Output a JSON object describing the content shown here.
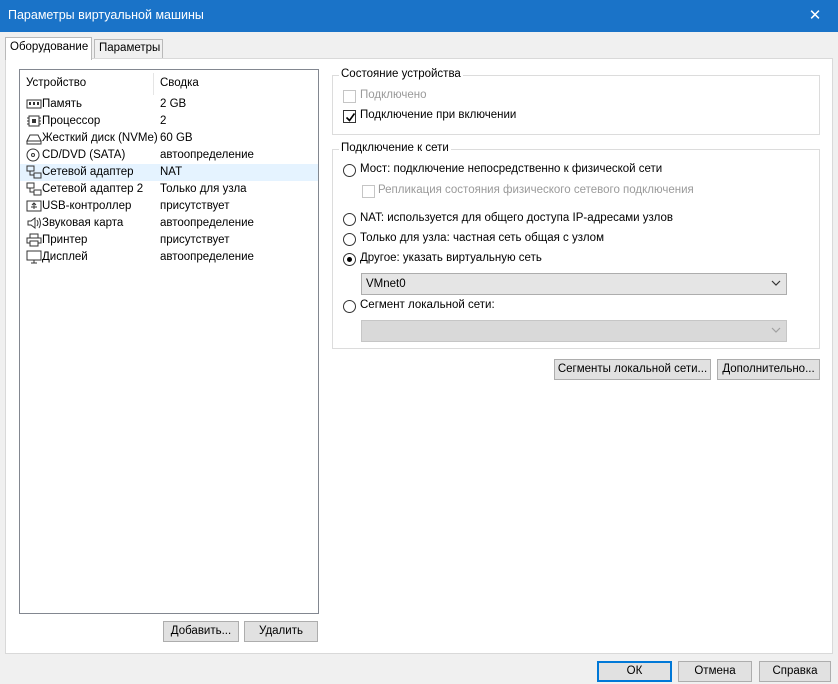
{
  "window": {
    "title": "Параметры виртуальной машины",
    "close_glyph": "✕"
  },
  "tabs": [
    {
      "label": "Оборудование"
    },
    {
      "label": "Параметры"
    }
  ],
  "device_list": {
    "header_device": "Устройство",
    "header_summary": "Сводка",
    "rows": [
      {
        "name": "Память",
        "summary": "2 GB",
        "icon": "memory-icon"
      },
      {
        "name": "Процессор",
        "summary": "2",
        "icon": "cpu-icon"
      },
      {
        "name": "Жесткий диск (NVMe)",
        "summary": "60 GB",
        "icon": "hard-disk-icon"
      },
      {
        "name": "CD/DVD (SATA)",
        "summary": "автоопределение",
        "icon": "cd-dvd-icon"
      },
      {
        "name": "Сетевой адаптер",
        "summary": "NAT",
        "icon": "network-adapter-icon",
        "selected": true
      },
      {
        "name": "Сетевой адаптер 2",
        "summary": "Только для узла",
        "icon": "network-adapter-icon"
      },
      {
        "name": "USB-контроллер",
        "summary": "присутствует",
        "icon": "usb-icon"
      },
      {
        "name": "Звуковая карта",
        "summary": "автоопределение",
        "icon": "sound-icon"
      },
      {
        "name": "Принтер",
        "summary": "присутствует",
        "icon": "printer-icon"
      },
      {
        "name": "Дисплей",
        "summary": "автоопределение",
        "icon": "display-icon"
      }
    ]
  },
  "buttons": {
    "add": "Добавить...",
    "remove": "Удалить",
    "lan_segments": "Сегменты локальной сети...",
    "advanced": "Дополнительно...",
    "ok": "ОК",
    "cancel": "Отмена",
    "help": "Справка"
  },
  "device_status": {
    "legend": "Состояние устройства",
    "connected": {
      "label": "Подключено",
      "checked": false,
      "disabled": true
    },
    "connect_at_power_on": {
      "label": "Подключение при включении",
      "checked": true
    }
  },
  "network_connection": {
    "legend": "Подключение к сети",
    "bridged": {
      "label": "Мост: подключение непосредственно к физической сети",
      "selected": false
    },
    "replicate": {
      "label": "Репликация состояния физического сетевого подключения",
      "checked": false,
      "disabled": true
    },
    "nat": {
      "label": "NAT: используется для общего доступа IP-адресами узлов",
      "selected": false
    },
    "host_only": {
      "label": "Только для узла: частная сеть общая с узлом",
      "selected": false
    },
    "custom": {
      "label": "Другое: указать виртуальную сеть",
      "selected": true,
      "value": "VMnet0"
    },
    "lan_segment": {
      "label": "Сегмент локальной сети:",
      "selected": false,
      "value": ""
    }
  }
}
